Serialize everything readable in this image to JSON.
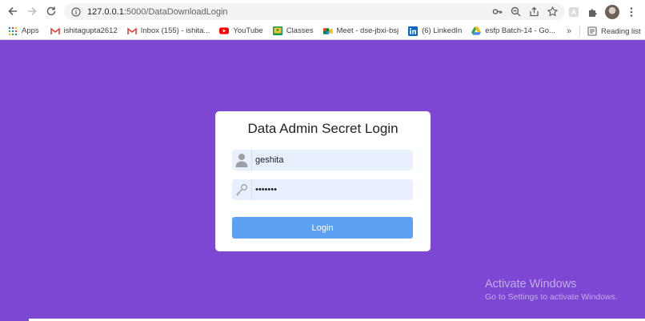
{
  "browser": {
    "url_host": "127.0.0.1",
    "url_path": ":5000/DataDownloadLogin",
    "bookmarks": [
      {
        "label": "Apps",
        "icon": "apps-grid-icon"
      },
      {
        "label": "ishitagupta2612",
        "icon": "gmail-icon"
      },
      {
        "label": "Inbox (155) - ishita...",
        "icon": "gmail-icon"
      },
      {
        "label": "YouTube",
        "icon": "youtube-icon"
      },
      {
        "label": "Classes",
        "icon": "classroom-icon"
      },
      {
        "label": "Meet - dse-jbxi-bsj",
        "icon": "meet-icon"
      },
      {
        "label": "(6) LinkedIn",
        "icon": "linkedin-icon"
      },
      {
        "label": "esfp Batch-14 - Go...",
        "icon": "drive-icon"
      }
    ],
    "more_bookmarks": "»",
    "reading_list": "Reading list"
  },
  "page": {
    "background": "#7b47d3",
    "title": "Data Admin Secret Login",
    "username_value": "geshita",
    "password_value": "•••••••",
    "login_label": "Login",
    "button_color": "#5da2f2"
  },
  "watermark": {
    "title": "Activate Windows",
    "subtitle": "Go to Settings to activate Windows."
  }
}
